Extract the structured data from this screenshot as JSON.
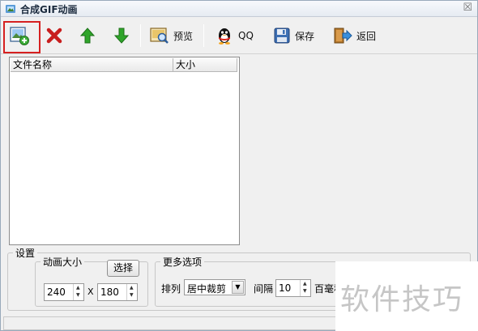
{
  "window": {
    "title": "合成GIF动画",
    "close_glyph": "☒"
  },
  "toolbar": {
    "add_icon": "add-image-icon",
    "delete_icon": "delete-icon",
    "up_icon": "arrow-up-icon",
    "down_icon": "arrow-down-icon",
    "preview_label": "预览",
    "qq_label": "QQ",
    "save_label": "保存",
    "back_label": "返回",
    "highlight_color": "#d62020"
  },
  "file_list": {
    "columns": [
      "文件名称",
      "大小"
    ],
    "rows": []
  },
  "settings": {
    "legend": "设置",
    "size_group": {
      "legend": "动画大小",
      "choose_label": "选择",
      "width": "240",
      "separator": "X",
      "height": "180"
    },
    "more_group": {
      "legend": "更多选项",
      "arrange_label": "排列",
      "arrange_value": "居中裁剪",
      "interval_label": "间隔",
      "interval_value": "10",
      "unit_label": "百毫秒"
    }
  },
  "watermark": {
    "text": "软件技巧"
  }
}
